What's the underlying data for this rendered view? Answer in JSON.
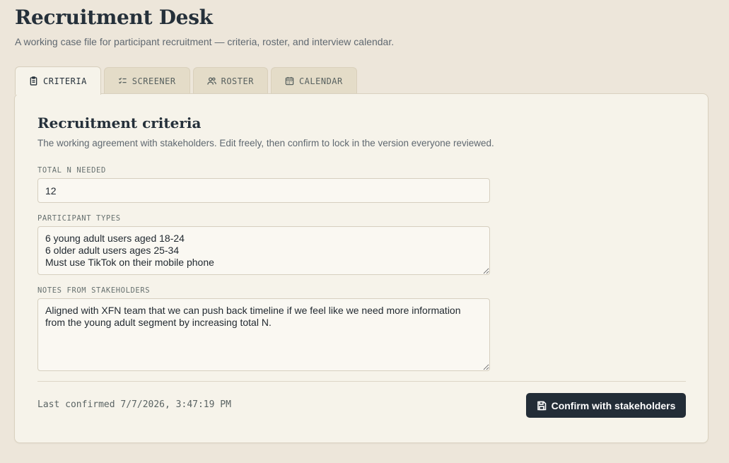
{
  "header": {
    "title": "Recruitment Desk",
    "subtitle": "A working case file for participant recruitment — criteria, roster, and interview calendar."
  },
  "tabs": [
    {
      "label": "CRITERIA",
      "icon": "clipboard-icon",
      "active": true
    },
    {
      "label": "SCREENER",
      "icon": "checklist-icon",
      "active": false
    },
    {
      "label": "ROSTER",
      "icon": "users-icon",
      "active": false
    },
    {
      "label": "CALENDAR",
      "icon": "calendar-icon",
      "active": false
    }
  ],
  "criteria": {
    "title": "Recruitment criteria",
    "description": "The working agreement with stakeholders. Edit freely, then confirm to lock in the version everyone reviewed.",
    "total_n": {
      "label": "TOTAL N NEEDED",
      "value": "12"
    },
    "participant_types": {
      "label": "PARTICIPANT TYPES",
      "value": "6 young adult users aged 18-24\n6 older adult users ages 25-34\nMust use TikTok on their mobile phone"
    },
    "notes": {
      "label": "NOTES FROM STAKEHOLDERS",
      "value": "Aligned with XFN team that we can push back timeline if we feel like we need more information from the young adult segment by increasing total N."
    },
    "last_confirmed": "Last confirmed 7/7/2026, 3:47:19 PM",
    "confirm_button": {
      "label": "Confirm with stakeholders",
      "icon": "save-icon"
    }
  },
  "colors": {
    "background": "#ede6da",
    "panel": "#f6f3ea",
    "primary_button": "#232d37",
    "text": "#25303a"
  }
}
